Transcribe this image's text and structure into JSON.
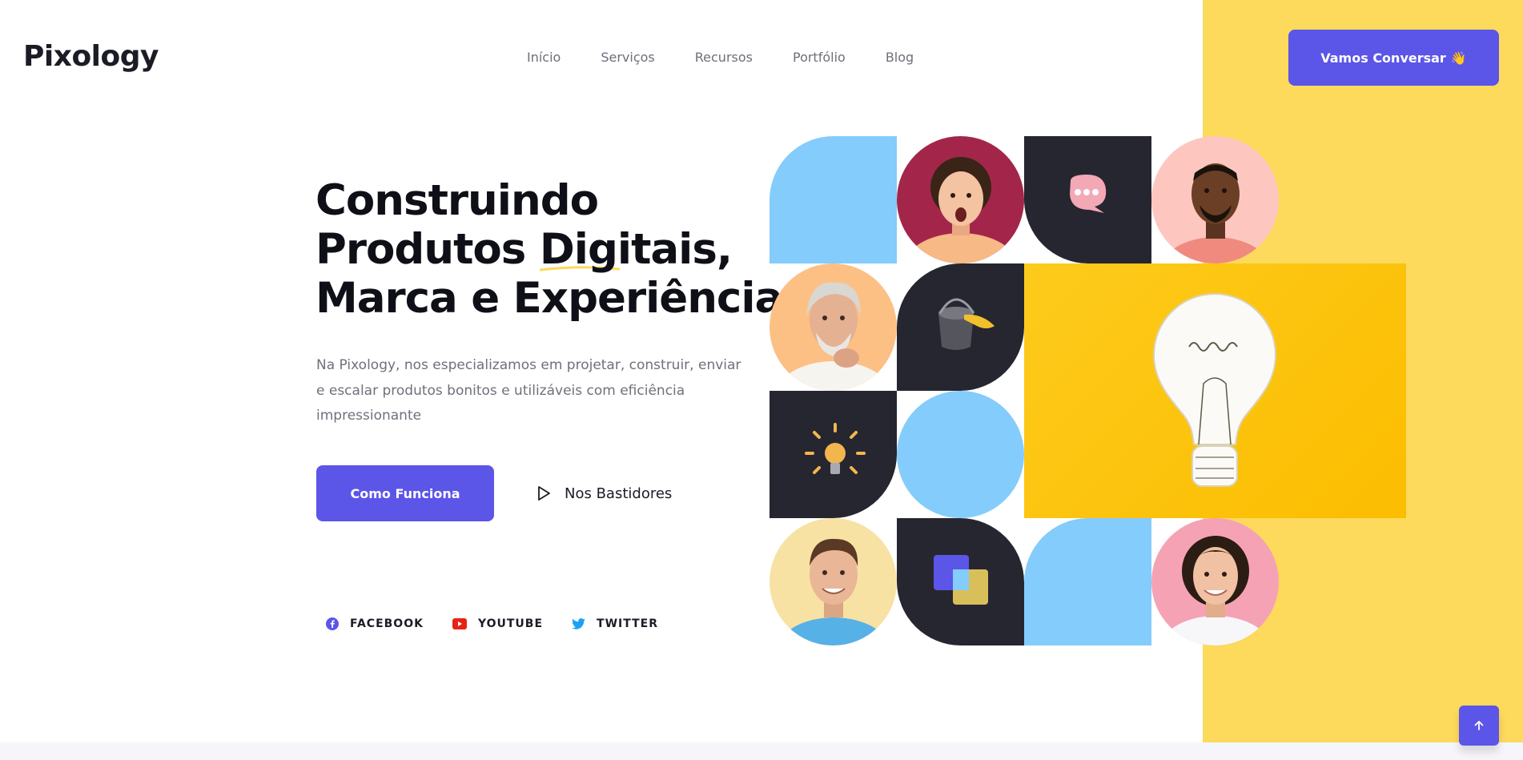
{
  "brand": {
    "logo": "Pixology"
  },
  "nav": {
    "items": [
      "Início",
      "Serviços",
      "Recursos",
      "Portfólio",
      "Blog"
    ]
  },
  "header": {
    "cta_label": "Vamos Conversar",
    "cta_emoji": "👋"
  },
  "hero": {
    "line1": "Construindo",
    "line2_before": "Produtos ",
    "line2_highlight": "Digitais",
    "line2_after": ",",
    "line3": "Marca e Experiência",
    "description": "Na Pixology, nos especializamos em projetar, construir, enviar e escalar produtos bonitos e utilizáveis com eficiência impressionante",
    "primary_button": "Como Funciona",
    "secondary_button": "Nos Bastidores"
  },
  "social": [
    {
      "label": "FACEBOOK",
      "icon": "facebook-icon",
      "color": "#5b55e8"
    },
    {
      "label": "YOUTUBE",
      "icon": "youtube-icon",
      "color": "#e62117"
    },
    {
      "label": "TWITTER",
      "icon": "twitter-icon",
      "color": "#1da1f2"
    }
  ],
  "colors": {
    "accent": "#5b55e8",
    "yellow_band": "#fdd95c",
    "tile_blue": "#84ccfb",
    "tile_dark": "#262630",
    "tile_yellow": "#fcc20a",
    "underline": "#fdd95c"
  },
  "grid_images": [
    "surprised-woman-photo",
    "chat-bubble-icon",
    "smiling-man-photo",
    "thinking-older-man-photo",
    "paint-bucket-icon",
    "idea-lightbulb-drawing",
    "glowing-lightbulb-icon",
    "smiling-young-man-photo",
    "overlapping-squares-icon",
    "smiling-young-woman-photo"
  ]
}
